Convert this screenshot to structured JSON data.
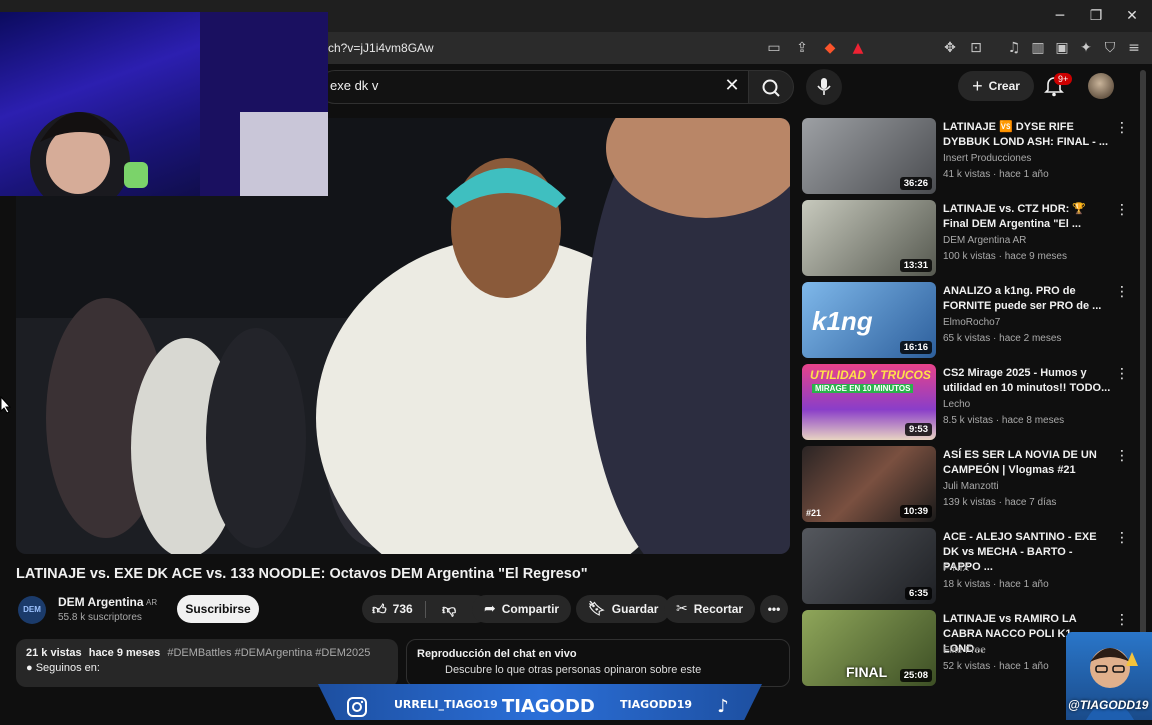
{
  "browser": {
    "url_fragment": "ch?v=jJ1i4vm8GAw",
    "window_controls": [
      "minimize",
      "maximize",
      "close"
    ]
  },
  "header": {
    "search_query": "exe dk v",
    "create_label": "Crear",
    "notifications_badge": "9+"
  },
  "video": {
    "title": "LATINAJE vs. EXE DK ACE vs. 133 NOODLE: Octavos DEM Argentina \"El Regreso\"",
    "channel_name": "DEM Argentina",
    "channel_country": "AR",
    "subscribers": "55.8 k suscriptores",
    "subscribe_label": "Suscribirse",
    "likes": "736",
    "share_label": "Compartir",
    "save_label": "Guardar",
    "clip_label": "Recortar"
  },
  "description": {
    "views": "21 k vistas",
    "age": "hace 9 meses",
    "hashtags": "#DEMBattles #DEMArgentina #DEM2025",
    "first_line": "● Seguinos en:"
  },
  "chat": {
    "title": "Reproducción del chat en vivo",
    "subtitle": "Descubre lo que otras personas opinaron sobre este"
  },
  "recommendations": [
    {
      "title": "LATINAJE 🆚 DYSE RIFE DYBBUK LOND ASH: FINAL - ...",
      "channel": "Insert Producciones",
      "views": "41 k vistas",
      "age": "hace 1 año",
      "duration": "36:26",
      "thumb_color": "#6a6d70"
    },
    {
      "title": "LATINAJE vs. CTZ HDR: 🏆 Final DEM Argentina \"El ...",
      "channel": "DEM Argentina AR",
      "views": "100 k vistas",
      "age": "hace 9 meses",
      "duration": "13:31",
      "thumb_color": "#8d9088"
    },
    {
      "title": "ANALIZO a k1ng. PRO de FORNITE puede ser PRO de ...",
      "channel": "ElmoRocho7",
      "views": "65 k vistas",
      "age": "hace 2 meses",
      "duration": "16:16",
      "thumb_color": "#3d7ec4"
    },
    {
      "title": "CS2 Mirage 2025 - Humos y utilidad en 10 minutos!! TODO...",
      "channel": "Lecho",
      "views": "8.5 k vistas",
      "age": "hace 8 meses",
      "duration": "9:53",
      "thumb_color": "#c0446a"
    },
    {
      "title": "ASÍ ES SER LA NOVIA DE UN CAMPEÓN | Vlogmas #21",
      "channel": "Juli Manzotti",
      "views": "139 k vistas",
      "age": "hace 7 días",
      "duration": "10:39",
      "thumb_color": "#2a2424"
    },
    {
      "title": "ACE - ALEJO SANTINO - EXE DK vs MECHA - BARTO - PAPPO ...",
      "channel": "F-NIX",
      "views": "18 k vistas",
      "age": "hace 1 año",
      "duration": "6:35",
      "thumb_color": "#3a3d42"
    },
    {
      "title": "LATINAJE vs RAMIRO LA CABRA NACCO POLI K1 LOND...",
      "channel": "Elite Free",
      "views": "52 k vistas",
      "age": "hace 1 año",
      "duration": "25:08",
      "thumb_color": "#5d7a3a"
    }
  ],
  "overlay": {
    "instagram_handle": "URRELI_TIAGO19",
    "brand": "TIAGODD",
    "tiktok_handle": "TIAGODD19",
    "tag": "@TIAGODD19"
  }
}
